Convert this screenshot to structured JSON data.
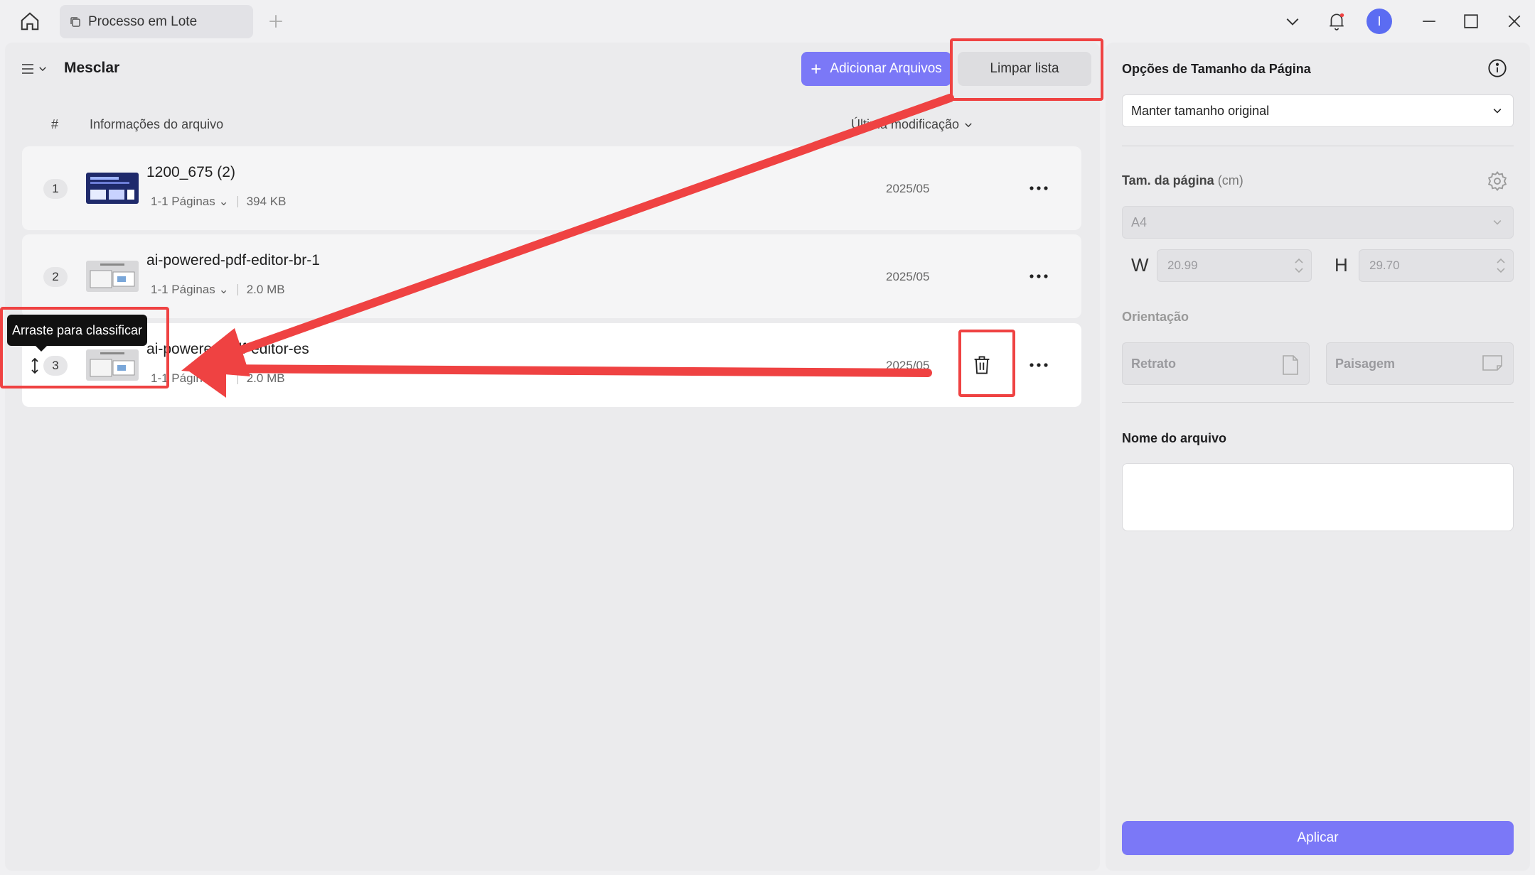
{
  "tab": {
    "label": "Processo em Lote"
  },
  "avatar": {
    "initial": "I"
  },
  "main": {
    "title": "Mesclar",
    "add_label": "Adicionar Arquivos",
    "clear_label": "Limpar lista",
    "columns": {
      "num": "#",
      "info": "Informações do arquivo",
      "modified": "Última modificação"
    },
    "files": [
      {
        "num": "1",
        "name": "1200_675 (2)",
        "pages": "1-1 Páginas",
        "size": "394 KB",
        "date": "2025/05"
      },
      {
        "num": "2",
        "name": "ai-powered-pdf-editor-br-1",
        "pages": "1-1 Páginas",
        "size": "2.0 MB",
        "date": "2025/05"
      },
      {
        "num": "3",
        "name": "ai-powered-pdf-editor-es",
        "pages": "1-1 Páginas",
        "size": "2.0 MB",
        "date": "2025/05"
      }
    ],
    "tooltip": "Arraste para classificar"
  },
  "side": {
    "title": "Opções de Tamanho da Página",
    "size_option": "Manter tamanho original",
    "page_size_label": "Tam. da página",
    "page_size_unit": "(cm)",
    "paper": "A4",
    "w_label": "W",
    "h_label": "H",
    "width": "20.99",
    "height": "29.70",
    "orientation_label": "Orientação",
    "portrait": "Retrato",
    "landscape": "Paisagem",
    "filename_label": "Nome do arquivo",
    "filename_value": "",
    "apply_label": "Aplicar"
  },
  "colors": {
    "accent": "#7b78f7",
    "annotation": "#ef4242"
  }
}
